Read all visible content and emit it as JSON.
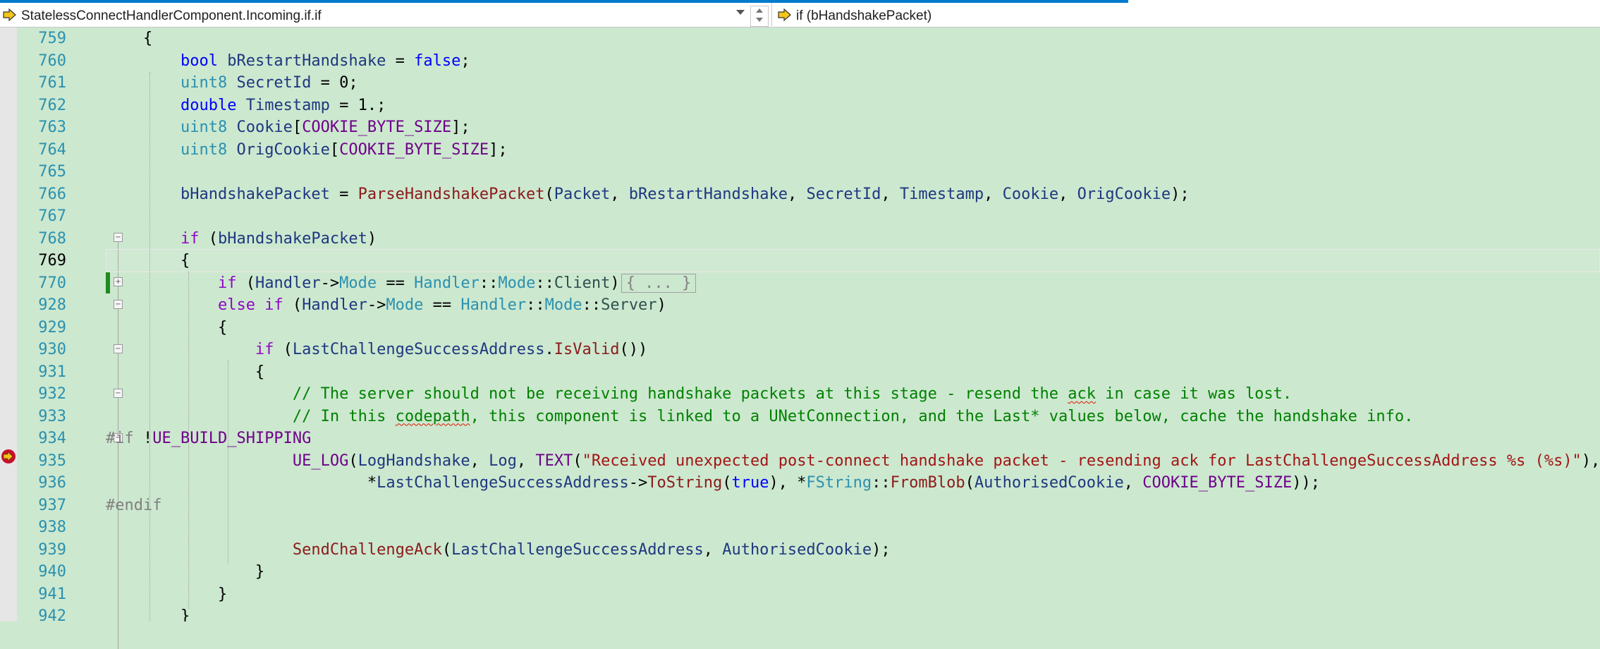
{
  "navbar": {
    "scope": "StatelessConnectHandlerComponent.Incoming.if.if",
    "member": "if (bHandshakePacket)",
    "arrow_icon": "yellow-arrow-icon"
  },
  "editor": {
    "background": "#cce8cf",
    "current_line": "769",
    "line_numbers": [
      "759",
      "760",
      "761",
      "762",
      "763",
      "764",
      "765",
      "766",
      "767",
      "768",
      "769",
      "770",
      "928",
      "929",
      "930",
      "931",
      "932",
      "933",
      "934",
      "935",
      "936",
      "937",
      "938",
      "939",
      "940",
      "941",
      "942"
    ],
    "collapsed_placeholder": "{ ... }",
    "breakpoint_icon": "breakpoint-arrow-icon"
  }
}
